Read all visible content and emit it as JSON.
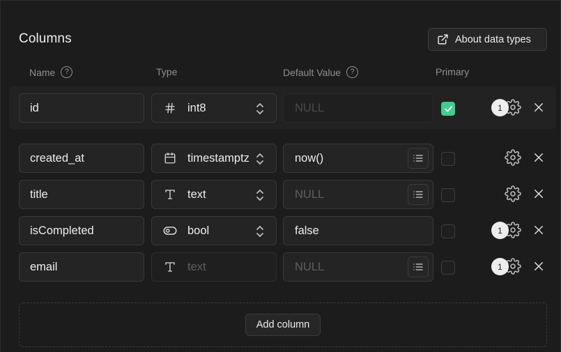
{
  "section": {
    "title": "Columns"
  },
  "about_button": {
    "label": "About data types"
  },
  "headers": {
    "name": "Name",
    "type": "Type",
    "default": "Default Value",
    "primary": "Primary"
  },
  "rows": [
    {
      "name": "id",
      "type_icon": "hash-icon",
      "type": "int8",
      "default": "",
      "default_placeholder": "NULL",
      "primary": true,
      "badge": "1",
      "has_list": false
    },
    {
      "name": "created_at",
      "type_icon": "calendar-icon",
      "type": "timestamptz",
      "default": "now()",
      "default_placeholder": "NULL",
      "primary": false,
      "badge": "",
      "has_list": true
    },
    {
      "name": "title",
      "type_icon": "text-type-icon",
      "type": "text",
      "default": "",
      "default_placeholder": "NULL",
      "primary": false,
      "badge": "",
      "has_list": true
    },
    {
      "name": "isCompleted",
      "type_icon": "toggle-icon",
      "type": "bool",
      "default": "false",
      "default_placeholder": "NULL",
      "primary": false,
      "badge": "1",
      "has_list": false
    },
    {
      "name": "email",
      "type_icon": "text-type-icon",
      "type": "",
      "type_placeholder": "text",
      "default": "",
      "default_placeholder": "NULL",
      "primary": false,
      "badge": "1",
      "has_list": true
    }
  ],
  "add_button": {
    "label": "Add column"
  },
  "colors": {
    "accent": "#3ecf8e",
    "background": "#1c1c1c"
  }
}
